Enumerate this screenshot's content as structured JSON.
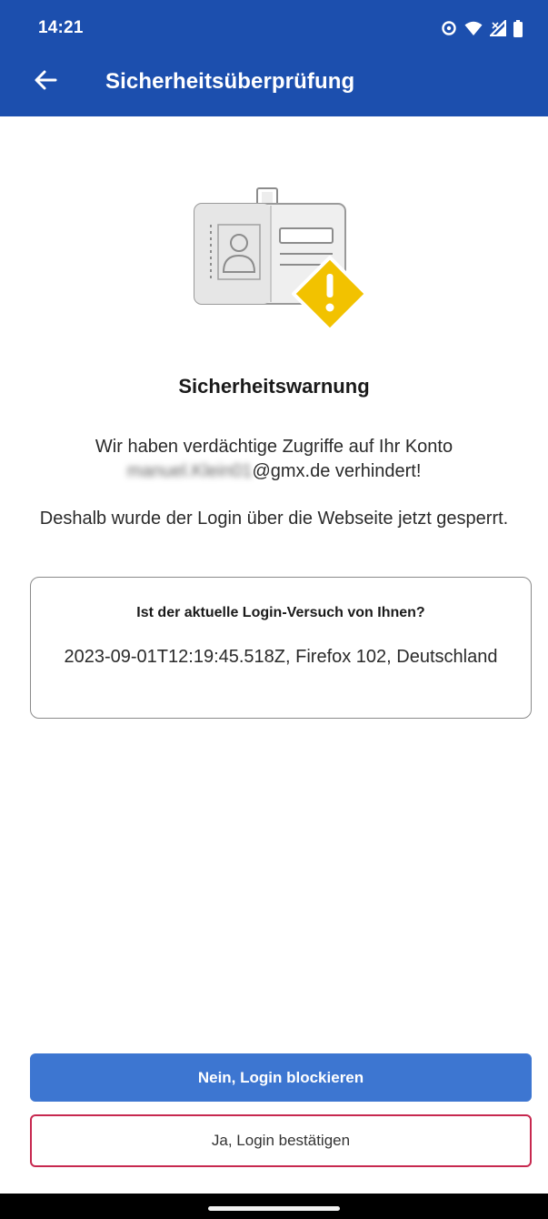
{
  "status_bar": {
    "time": "14:21"
  },
  "app_bar": {
    "title": "Sicherheitsüberprüfung",
    "back_icon": "arrow-left-icon",
    "background": "#1c4fae"
  },
  "illustration": {
    "icon": "id-badge-warning-icon",
    "warning_color": "#f2c200"
  },
  "warning": {
    "heading": "Sicherheitswarnung",
    "line1": "Wir haben verdächtige Zugriffe auf Ihr Konto",
    "email_blurred": "manuel.Klein01",
    "email_domain_suffix": "@gmx.de verhindert!",
    "line2": "Deshalb wurde der Login über die Webseite jetzt gesperrt."
  },
  "login_attempt": {
    "question": "Ist der aktuelle Login-Versuch von Ihnen?",
    "details": "2023-09-01T12:19:45.518Z, Firefox 102, Deutschland"
  },
  "actions": {
    "block_label": "Nein, Login blockieren",
    "confirm_label": "Ja, Login bestätigen",
    "block_color": "#3d76d1",
    "confirm_border_color": "#c7284f"
  }
}
